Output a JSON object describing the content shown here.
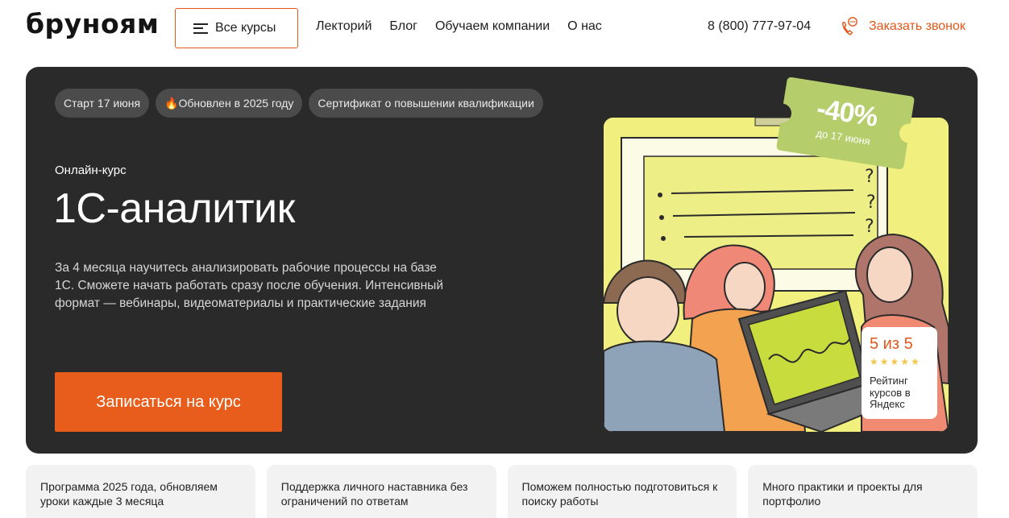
{
  "header": {
    "logo": "бруноям",
    "all_courses": "Все курсы",
    "nav": [
      "Лекторий",
      "Блог",
      "Обучаем компании",
      "О нас"
    ],
    "phone": "8 (800) 777-97-04",
    "callback": "Заказать звонок"
  },
  "hero": {
    "tags": [
      "Старт 17 июня",
      "🔥Обновлен в 2025 году",
      "Сертификат о повышении квалификации"
    ],
    "kicker": "Онлайн-курс",
    "title": "1С-аналитик",
    "description": "За 4 месяца научитесь анализировать рабочие процессы на базе 1С. Сможете начать работать сразу после обучения. Интенсивный формат — вебинары, видеоматериалы и практические задания",
    "cta": "Записаться на курс",
    "discount": {
      "value": "-40%",
      "until": "до 17 июня"
    },
    "rating": {
      "score": "5 из 5",
      "stars": 5,
      "label": "Рейтинг курсов в Яндекс"
    }
  },
  "features": [
    "Программа 2025 года, обновляем уроки каждые 3 месяца",
    "Поддержка личного наставника без ограничений по ответам",
    "Поможем полностью подготовиться к поиску работы",
    "Много практики и проекты для портфолио"
  ],
  "colors": {
    "accent": "#e85d1c",
    "hero_bg": "#2a2a2a",
    "tag_bg": "#4b4b4b",
    "discount_green": "#b5cd6b",
    "illustration_bg": "#f1ef7e"
  },
  "icons": {
    "menu": "burger-icon",
    "callback": "phone-chat-icon",
    "star": "star-icon"
  }
}
